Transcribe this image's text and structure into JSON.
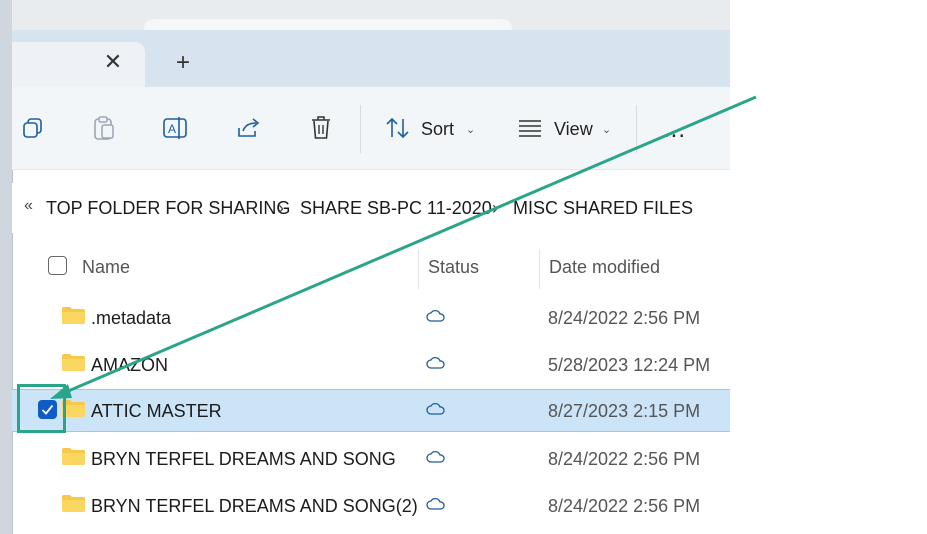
{
  "tabs": {
    "close_glyph": "✕",
    "new_glyph": "+"
  },
  "toolbar": {
    "icons": [
      "copy-icon",
      "paste-icon",
      "rename-icon",
      "share-icon",
      "delete-icon",
      "sort-icon",
      "view-icon"
    ],
    "sort_label": "Sort",
    "view_label": "View",
    "more_label": "...",
    "chevron": "⌄"
  },
  "breadcrumb": {
    "overflow": "«",
    "separator": "›",
    "items": [
      "TOP FOLDER FOR SHARING",
      "SHARE SB-PC 11-2020",
      "MISC SHARED FILES"
    ]
  },
  "columns": {
    "name": "Name",
    "status": "Status",
    "date_modified": "Date modified"
  },
  "rows": [
    {
      "name": ".metadata",
      "status": "cloud-icon",
      "date": "8/24/2022 2:56 PM",
      "selected": false
    },
    {
      "name": "AMAZON",
      "status": "cloud-icon",
      "date": "5/28/2023 12:24 PM",
      "selected": false
    },
    {
      "name": "ATTIC MASTER",
      "status": "cloud-icon",
      "date": "8/27/2023 2:15 PM",
      "selected": true
    },
    {
      "name": "BRYN TERFEL DREAMS AND SONG",
      "status": "cloud-icon",
      "date": "8/24/2022 2:56 PM",
      "selected": false
    },
    {
      "name": "BRYN TERFEL DREAMS AND SONG(2)",
      "status": "cloud-icon",
      "date": "8/24/2022 2:56 PM",
      "selected": false
    }
  ],
  "colors": {
    "annotation": "#2aa58a",
    "selection": "#cce4f7",
    "checkbox_checked": "#0f5cc7",
    "folder": "#f7c948"
  }
}
